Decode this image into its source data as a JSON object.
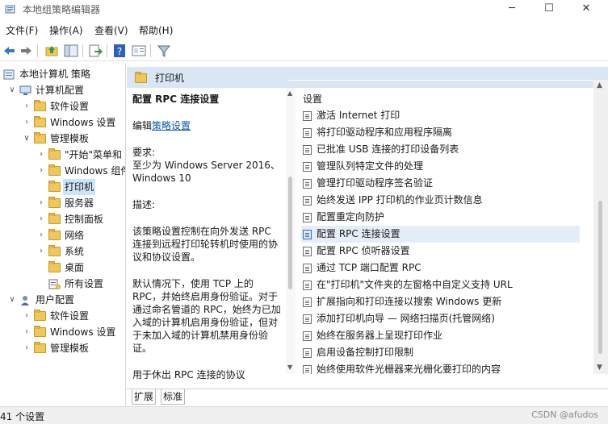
{
  "window": {
    "title": "本地组策略编辑器",
    "minimize": "─",
    "maximize": "☐",
    "close": "✕"
  },
  "menu": [
    "文件(F)",
    "操作(A)",
    "查看(V)",
    "帮助(H)"
  ],
  "tree": {
    "items": [
      {
        "label": "本地计算机 策略",
        "level": 0,
        "icon": "policy-icon",
        "chev": ""
      },
      {
        "label": "计算机配置",
        "level": 1,
        "icon": "computer-icon",
        "chev": "∨"
      },
      {
        "label": "软件设置",
        "level": 2,
        "icon": "folder-icon",
        "chev": "›"
      },
      {
        "label": "Windows 设置",
        "level": 2,
        "icon": "folder-icon",
        "chev": "›"
      },
      {
        "label": "管理模板",
        "level": 2,
        "icon": "folder-icon",
        "chev": "∨"
      },
      {
        "label": "\"开始\"菜单和",
        "level": 3,
        "icon": "folder-icon",
        "chev": "›"
      },
      {
        "label": "Windows 组件",
        "level": 3,
        "icon": "folder-icon",
        "chev": "›"
      },
      {
        "label": "打印机",
        "level": 3,
        "icon": "folder-icon",
        "chev": "",
        "selected": true
      },
      {
        "label": "服务器",
        "level": 3,
        "icon": "folder-icon",
        "chev": "›"
      },
      {
        "label": "控制面板",
        "level": 3,
        "icon": "folder-icon",
        "chev": "›"
      },
      {
        "label": "网络",
        "level": 3,
        "icon": "folder-icon",
        "chev": "›"
      },
      {
        "label": "系统",
        "level": 3,
        "icon": "folder-icon",
        "chev": "›"
      },
      {
        "label": "桌面",
        "level": 3,
        "icon": "folder-icon",
        "chev": ""
      },
      {
        "label": "所有设置",
        "level": 3,
        "icon": "all-settings-icon",
        "chev": ""
      },
      {
        "label": "用户配置",
        "level": 1,
        "icon": "user-icon",
        "chev": "∨"
      },
      {
        "label": "软件设置",
        "level": 2,
        "icon": "folder-icon",
        "chev": "›"
      },
      {
        "label": "Windows 设置",
        "level": 2,
        "icon": "folder-icon",
        "chev": "›"
      },
      {
        "label": "管理模板",
        "level": 2,
        "icon": "folder-icon",
        "chev": "›"
      }
    ]
  },
  "header": {
    "title": "打印机"
  },
  "description": {
    "title": "配置 RPC 连接设置",
    "edit_prefix": "编辑",
    "edit_link": "策略设置",
    "req_label": "要求:",
    "req_text": "至少为 Windows Server 2016、Windows 10",
    "desc_label": "描述:",
    "p1": "该策略设置控制在向外发送 RPC 连接到远程打印轮转机时使用的协议和协议设置。",
    "p2": "默认情况下，使用 TCP 上的 RPC，并始终启用身份验证。对于通过命名管道的 RPC，始终为已加入域的计算机启用身份验证，但对于未加入域的计算机禁用身份验证。",
    "p3": "用于休出 RPC 连接的协议"
  },
  "list": {
    "column": "设置",
    "rows": [
      "激活 Internet 打印",
      "将打印驱动程序和应用程序隔离",
      "已批准 USB 连接的打印设备列表",
      "管理队列特定文件的处理",
      "管理打印驱动程序签名验证",
      "始终发送 IPP 打印机的作业页计数信息",
      "配置重定向防护",
      "配置 RPC 连接设置",
      "配置 RPC 侦听器设置",
      "通过 TCP 端口配置 RPC",
      "在\"打印机\"文件夹的左窗格中自定义支持 URL",
      "扩展指向和打印连接以搜索 Windows 更新",
      "添加打印机向导 — 网络扫描页(托管网络)",
      "始终在服务器上呈现打印作业",
      "启用设备控制打印限制",
      "始终使用软件光栅器来光栅化要打印的内容"
    ],
    "selected_index": 7
  },
  "tabs": [
    "扩展",
    "标准"
  ],
  "status": {
    "text": "41 个设置",
    "watermark": "CSDN @afudos"
  }
}
